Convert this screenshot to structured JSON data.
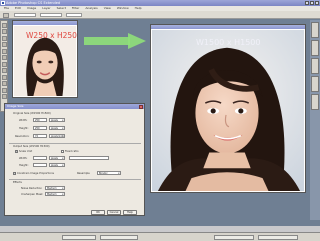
{
  "app": {
    "title": "Adobe Photoshop CS Extended",
    "menu": [
      "File",
      "Edit",
      "Image",
      "Layer",
      "Select",
      "Filter",
      "Analysis",
      "View",
      "Window",
      "Help"
    ]
  },
  "small_image": {
    "label": "W250 x H250"
  },
  "large_image": {
    "label": "W1500 x H1500"
  },
  "dialog": {
    "title": "Image Size",
    "original_size": "Original Size (W1500 H1500)",
    "width_label": "Width:",
    "height_label": "Height:",
    "resolution_label": "Resolution:",
    "width_value": "250",
    "height_value": "250",
    "resolution_value": "72",
    "unit_pixels": "pixels",
    "unit_ppi": "pixels/inch",
    "output_size": "Output Size (W1500 H1500)",
    "scale_option": "Scale Unit",
    "fixed_ratio": "Fixed ratio",
    "constrain": "Constrain Image Proportions",
    "resample_label": "Resample",
    "resample_value": "Bicubic",
    "effects_label": "Effects",
    "noise_label": "Noise Reduction",
    "noise_value": "Medium",
    "sharpen_label": "Unsharpen Mask",
    "sharpen_value": "Medium",
    "ok": "OK",
    "cancel": "Cancel",
    "help": "Help"
  },
  "colors": {
    "label_red": "#e0473f",
    "arrow_green": "#8fe07a"
  }
}
